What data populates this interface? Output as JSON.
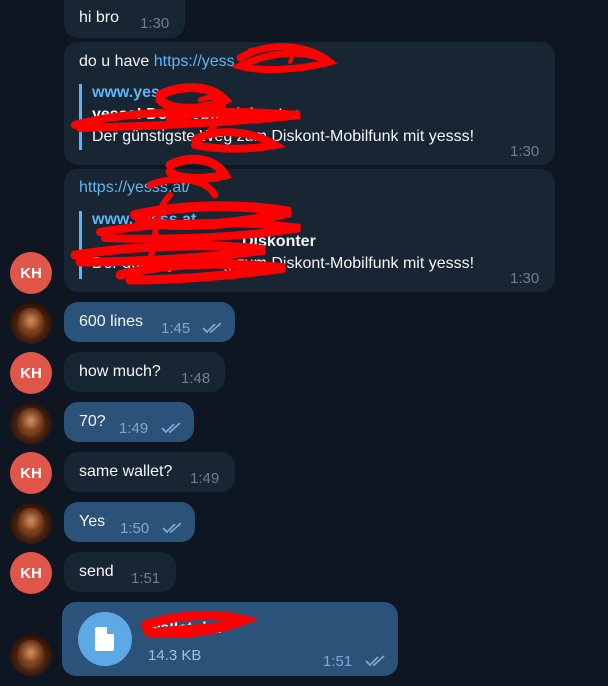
{
  "messages": {
    "m1": {
      "text": "hi bro",
      "time": "1:30"
    },
    "m2": {
      "text_prefix": "do u have ",
      "link": "https://yess",
      "preview_site": "www.yess",
      "preview_title": "yesss! Der Mobil-Diskonter",
      "preview_desc": "Der günstigste Weg zum Diskont-Mobilfunk mit yesss!",
      "time": "1:30"
    },
    "m3": {
      "link": "https://yesss.at/",
      "preview_site": "www.yesss.at",
      "preview_title": "Diskonter",
      "preview_desc": "Der günstigste Weg zum Diskont-Mobilfunk mit yesss!",
      "time": "1:30"
    },
    "m4": {
      "text": "600 lines",
      "time": "1:45"
    },
    "m5": {
      "text": "how much?",
      "time": "1:48"
    },
    "m6": {
      "text": "70?",
      "time": "1:49"
    },
    "m7": {
      "text": "same wallet?",
      "time": "1:49"
    },
    "m8": {
      "text": "Yes",
      "time": "1:50"
    },
    "m9": {
      "text": "send",
      "time": "1:51"
    },
    "m10": {
      "file_name": "wallet.dat",
      "file_size": "14.3 KB",
      "time": "1:51"
    }
  },
  "avatars": {
    "contact_initials": "KH"
  },
  "colors": {
    "background": "#0e1621",
    "incoming_bubble": "#182533",
    "outgoing_bubble": "#2b5278",
    "link": "#5eb5f7",
    "contact_avatar": "#e0574a",
    "redaction": "#ff0000"
  },
  "icons": {
    "read_receipt": "double-check-icon",
    "file": "file-icon"
  }
}
